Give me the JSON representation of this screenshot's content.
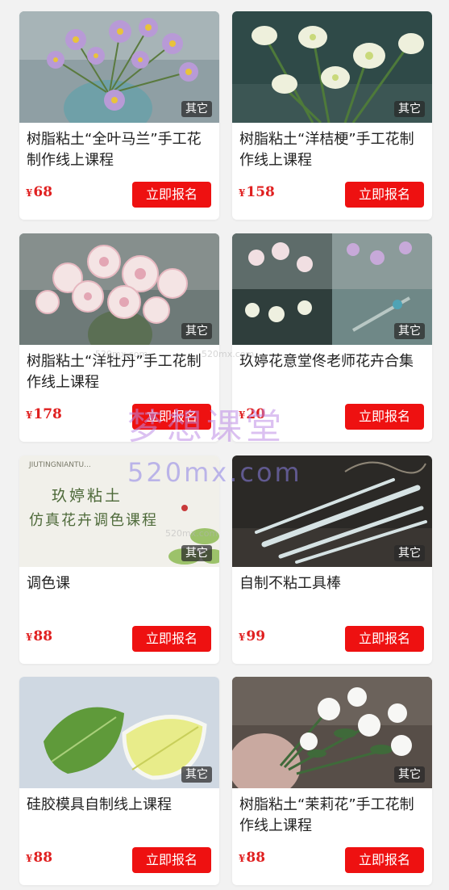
{
  "tag_label": "其它",
  "enroll_label": "立即报名",
  "currency": "¥",
  "courses": [
    {
      "title": "树脂粘土“全叶马兰”手工花制作线上课程",
      "price": "68",
      "image": "purple-daisy-vase-photo"
    },
    {
      "title": "树脂粘土“洋桔梗”手工花制作线上课程",
      "price": "158",
      "image": "white-lisianthus-photo"
    },
    {
      "title": "树脂粘土“洋牡丹”手工花制作线上课程",
      "price": "178",
      "image": "pink-ranunculus-photo"
    },
    {
      "title": "玖婷花意堂佟老师花卉合集",
      "price": "20",
      "image": "flower-collection-collage"
    },
    {
      "title": "调色课",
      "price": "88",
      "image": "color-course-poster"
    },
    {
      "title": "自制不粘工具棒",
      "price": "99",
      "image": "clay-tool-sticks-photo"
    },
    {
      "title": "硅胶模具自制线上课程",
      "price": "88",
      "image": "silicone-leaf-mold-photo"
    },
    {
      "title": "树脂粘土“茉莉花”手工花制作线上课程",
      "price": "88",
      "image": "jasmine-flower-photo"
    }
  ],
  "poster": {
    "pinyin": "JIUTINGNIANTU...",
    "line1": "玖婷粘土",
    "line2": "仿真花卉调色课程"
  },
  "watermark": {
    "title": "梦想课堂",
    "url": "520mx.com",
    "small": "520mx.com"
  },
  "colors": {
    "accent": "#ee1111",
    "price": "#e02020",
    "background": "#f2f2f2"
  }
}
